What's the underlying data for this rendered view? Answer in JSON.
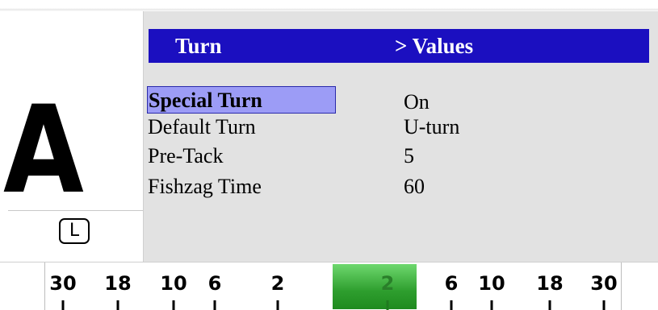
{
  "left_panel": {
    "big_letter": "A",
    "badge": "L"
  },
  "header": {
    "title": "Turn",
    "subtitle": "> Values",
    "background_color": "#1b0fc0"
  },
  "menu": {
    "items": [
      {
        "label": "Special Turn",
        "value": "On",
        "selected": true
      },
      {
        "label": "Default Turn",
        "value": "U-turn",
        "selected": false
      },
      {
        "label": "Pre-Tack",
        "value": "5",
        "selected": false
      },
      {
        "label": "Fishzag Time",
        "value": "60",
        "selected": false
      }
    ],
    "selection_color": "#9c9cf6"
  },
  "scale": {
    "ticks": [
      "30",
      "18",
      "10",
      "6",
      "2",
      "2",
      "6",
      "10",
      "18",
      "30"
    ],
    "highlight_color": "#2e9e2e"
  }
}
